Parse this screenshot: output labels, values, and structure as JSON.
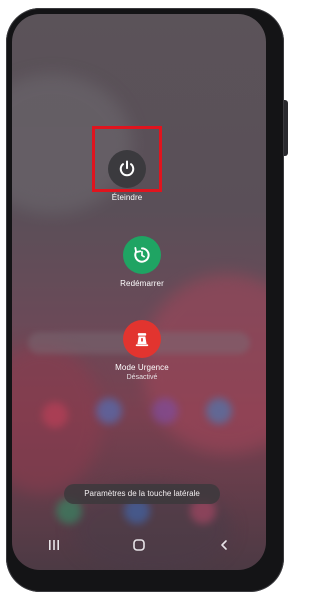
{
  "power_menu": {
    "power_off": {
      "label": "Éteindre",
      "icon": "power-icon",
      "bg": "#3b3a3e"
    },
    "restart": {
      "label": "Redémarrer",
      "icon": "restart-icon",
      "bg": "#1fa463"
    },
    "emergency": {
      "label": "Mode Urgence",
      "status": "Désactivé",
      "icon": "emergency-icon",
      "bg": "#e2342f"
    }
  },
  "side_key_settings": {
    "label": "Paramètres de la touche latérale"
  },
  "nav": {
    "recents": "recent-apps-icon",
    "home": "home-icon",
    "back": "back-icon"
  },
  "colors": {
    "highlight": "#e0141e"
  }
}
